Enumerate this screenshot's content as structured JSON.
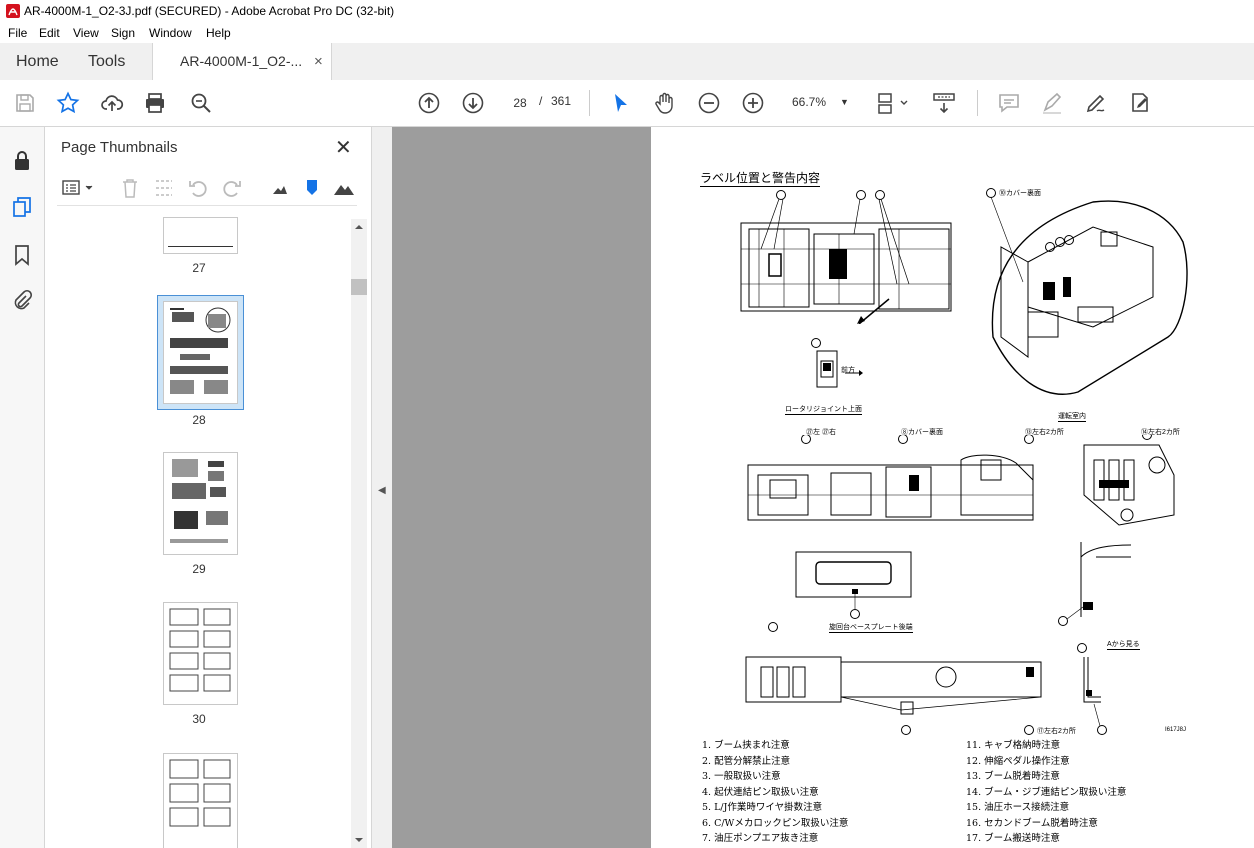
{
  "window": {
    "title": "AR-4000M-1_O2-3J.pdf (SECURED) - Adobe Acrobat Pro DC (32-bit)",
    "minimize_icon": "minimize-icon",
    "maximize_icon": "maximize-icon",
    "close_icon": "close-icon"
  },
  "menu": [
    "File",
    "Edit",
    "View",
    "Sign",
    "Window",
    "Help"
  ],
  "tabs": {
    "home": "Home",
    "tools": "Tools",
    "doc": "AR-4000M-1_O2-...",
    "doc_close": "×"
  },
  "toolbar": {
    "page_current": "28",
    "page_sep": "/",
    "page_total": "361",
    "zoom": "66.7%",
    "zoom_arrow": "▼"
  },
  "thumbnail_panel": {
    "title": "Page Thumbnails",
    "close": "✕",
    "pages": [
      "27",
      "28",
      "29",
      "30"
    ]
  },
  "collapse_arrow": "◀",
  "pdf_page": {
    "heading": "ラベル位置と警告内容",
    "captions": {
      "rotary_joint": "ロータリジョイント上面",
      "cab_interior": "運転室内",
      "turntable_plate": "旋回台ベースプレート後端",
      "view_a": "Aから見る",
      "front_label": "前方",
      "cover_back": "⑩カバー裏面",
      "cover_back2": "⑧カバー裏面",
      "left_27": "㉗左 ㉗右",
      "left_right_13": "⑬左右2カ所",
      "left_right_14": "⑭左右2カ所",
      "left_right_17": "⑰左右2カ所",
      "drawing_code": "I617J8J"
    },
    "notes_left": [
      "1. ブーム挟まれ注意",
      "2. 配管分解禁止注意",
      "3. 一般取扱い注意",
      "4. 起伏連結ピン取扱い注意",
      "5. L/J作業時ワイヤ掛数注意",
      "6. C/Wメカロックピン取扱い注意",
      "7. 油圧ポンプエア抜き注意"
    ],
    "notes_right": [
      "11. キャブ格納時注意",
      "12. 伸縮ペダル操作注意",
      "13. ブーム脱着時注意",
      "14. ブーム・ジブ連結ピン取扱い注意",
      "15. 油圧ホース接続注意",
      "16. セカンドブーム脱着時注意",
      "17. ブーム搬送時注意"
    ]
  }
}
